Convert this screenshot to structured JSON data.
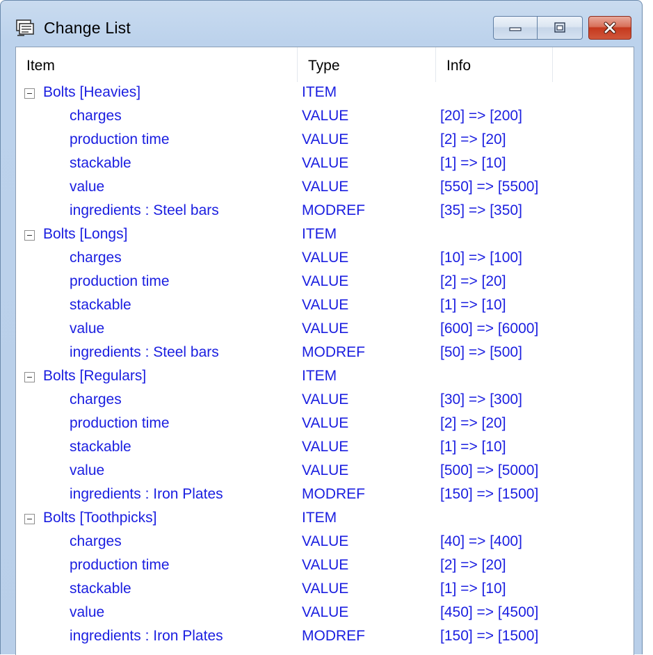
{
  "window": {
    "title": "Change List"
  },
  "icons": {
    "app": "change-list-app-icon",
    "minimize": "minimize-icon",
    "maximize": "maximize-icon",
    "close": "close-icon",
    "expander": "collapse-minus-icon"
  },
  "colors": {
    "row_text": "#1a1ee0",
    "close_button": "#c5381d"
  },
  "columns": {
    "item": "Item",
    "type": "Type",
    "info": "Info"
  },
  "groups": [
    {
      "label": "Bolts [Heavies]",
      "type": "ITEM",
      "children": [
        {
          "label": "charges",
          "type": "VALUE",
          "info": "[20] => [200]"
        },
        {
          "label": "production time",
          "type": "VALUE",
          "info": "[2] => [20]"
        },
        {
          "label": "stackable",
          "type": "VALUE",
          "info": "[1] => [10]"
        },
        {
          "label": "value",
          "type": "VALUE",
          "info": "[550] => [5500]"
        },
        {
          "label": "ingredients : Steel bars",
          "type": "MODREF",
          "info": "[35] => [350]"
        }
      ]
    },
    {
      "label": "Bolts [Longs]",
      "type": "ITEM",
      "children": [
        {
          "label": "charges",
          "type": "VALUE",
          "info": "[10] => [100]"
        },
        {
          "label": "production time",
          "type": "VALUE",
          "info": "[2] => [20]"
        },
        {
          "label": "stackable",
          "type": "VALUE",
          "info": "[1] => [10]"
        },
        {
          "label": "value",
          "type": "VALUE",
          "info": "[600] => [6000]"
        },
        {
          "label": "ingredients : Steel bars",
          "type": "MODREF",
          "info": "[50] => [500]"
        }
      ]
    },
    {
      "label": "Bolts [Regulars]",
      "type": "ITEM",
      "children": [
        {
          "label": "charges",
          "type": "VALUE",
          "info": "[30] => [300]"
        },
        {
          "label": "production time",
          "type": "VALUE",
          "info": "[2] => [20]"
        },
        {
          "label": "stackable",
          "type": "VALUE",
          "info": "[1] => [10]"
        },
        {
          "label": "value",
          "type": "VALUE",
          "info": "[500] => [5000]"
        },
        {
          "label": "ingredients : Iron Plates",
          "type": "MODREF",
          "info": "[150] => [1500]"
        }
      ]
    },
    {
      "label": "Bolts [Toothpicks]",
      "type": "ITEM",
      "children": [
        {
          "label": "charges",
          "type": "VALUE",
          "info": "[40] => [400]"
        },
        {
          "label": "production time",
          "type": "VALUE",
          "info": "[2] => [20]"
        },
        {
          "label": "stackable",
          "type": "VALUE",
          "info": "[1] => [10]"
        },
        {
          "label": "value",
          "type": "VALUE",
          "info": "[450] => [4500]"
        },
        {
          "label": "ingredients : Iron Plates",
          "type": "MODREF",
          "info": "[150] => [1500]"
        }
      ]
    }
  ]
}
